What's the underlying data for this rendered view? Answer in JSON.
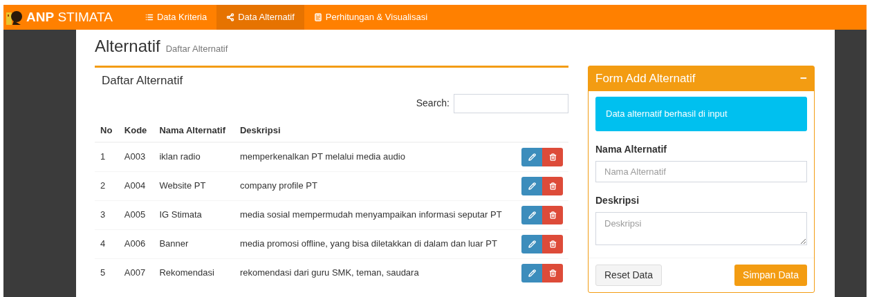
{
  "navbar": {
    "brand_bold": "ANP",
    "brand_rest": "STIMATA",
    "items": [
      {
        "label": "Data Kriteria",
        "kind": "list",
        "selected": false
      },
      {
        "label": "Data Alternatif",
        "kind": "share",
        "selected": true
      },
      {
        "label": "Perhitungan & Visualisasi",
        "kind": "calculator",
        "selected": false
      }
    ]
  },
  "page": {
    "title": "Alternatif",
    "subtitle": "Daftar Alternatif"
  },
  "list_panel": {
    "title": "Daftar Alternatif",
    "search_label": "Search:",
    "columns": [
      "No",
      "Kode",
      "Nama Alternatif",
      "Deskripsi"
    ],
    "rows": [
      {
        "no": "1",
        "kode": "A003",
        "nama": "iklan radio",
        "deskripsi": "memperkenalkan PT melalui media audio"
      },
      {
        "no": "2",
        "kode": "A004",
        "nama": "Website PT",
        "deskripsi": "company profile PT"
      },
      {
        "no": "3",
        "kode": "A005",
        "nama": "IG Stimata",
        "deskripsi": "media sosial mempermudah menyampaikan informasi seputar PT"
      },
      {
        "no": "4",
        "kode": "A006",
        "nama": "Banner",
        "deskripsi": "media promosi offline, yang bisa diletakkan di dalam dan luar PT"
      },
      {
        "no": "5",
        "kode": "A007",
        "nama": "Rekomendasi",
        "deskripsi": "rekomendasi dari guru SMK, teman, saudara"
      }
    ]
  },
  "form_panel": {
    "title": "Form Add Alternatif",
    "collapse": "−",
    "alert": "Data alternatif berhasil di input",
    "fields": [
      {
        "label": "Nama Alternatif",
        "placeholder": "Nama Alternatif",
        "kind": "input"
      },
      {
        "label": "Deskripsi",
        "placeholder": "Deskripsi",
        "kind": "textarea"
      }
    ],
    "reset_button": "Reset Data",
    "save_button": "Simpan Data"
  }
}
